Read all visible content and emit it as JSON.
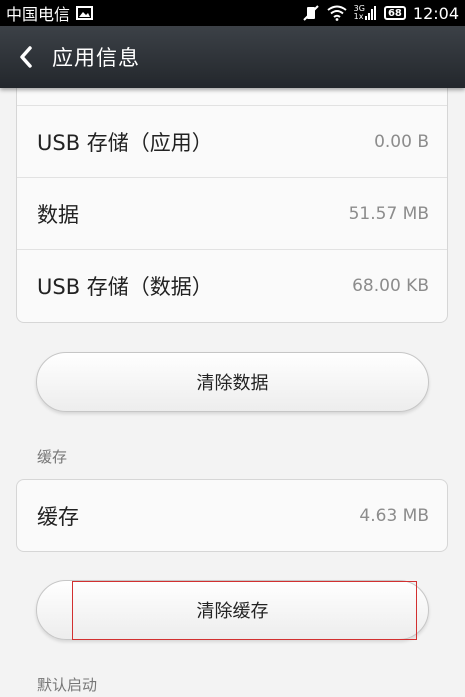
{
  "status_bar": {
    "carrier": "中国电信",
    "net_top": "3G",
    "net_bottom": "1x",
    "battery": "68",
    "time": "12:04"
  },
  "action_bar": {
    "title": "应用信息"
  },
  "storage_card": {
    "rows": [
      {
        "label": "USB 存储（应用）",
        "value": "0.00 B"
      },
      {
        "label": "数据",
        "value": "51.57 MB"
      },
      {
        "label": "USB 存储（数据）",
        "value": "68.00 KB"
      }
    ]
  },
  "clear_data_button": "清除数据",
  "cache_section": {
    "header": "缓存",
    "row_label": "缓存",
    "row_value": "4.63 MB"
  },
  "clear_cache_button": "清除缓存",
  "default_launch_header": "默认启动",
  "colors": {
    "action_bar": "#2f3338",
    "highlight": "#d23030"
  }
}
